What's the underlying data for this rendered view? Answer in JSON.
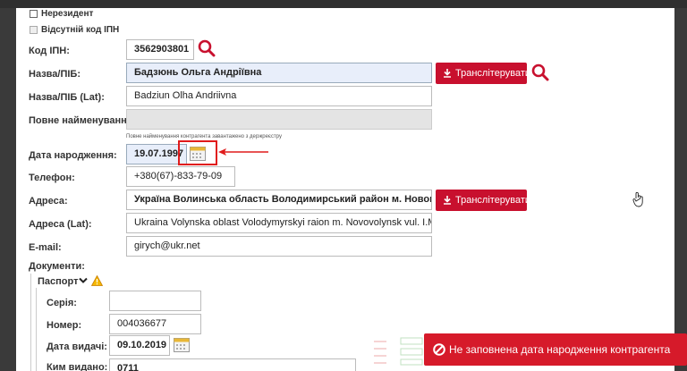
{
  "checkboxes": {
    "nonresident": "Нерезидент",
    "no_ipn": "Відсутній код ІПН"
  },
  "fields": {
    "ipn": {
      "label": "Код ІПН:",
      "value": "3562903801"
    },
    "name": {
      "label": "Назва/ПІБ:",
      "value": "Бадзюнь Ольга Андріївна"
    },
    "name_lat": {
      "label": "Назва/ПІБ (Lat):",
      "value": "Badziun Olha Andriivna"
    },
    "full_name": {
      "label": "Повне найменування:",
      "value": "",
      "hint": "Повне найменування контрагента завантажено з держреєстру"
    },
    "birth_date": {
      "label": "Дата народження:",
      "value": "19.07.1997"
    },
    "phone": {
      "label": "Телефон:",
      "value": "+380(67)-833-79-09"
    },
    "address": {
      "label": "Адреса:",
      "value": "Україна Волинська область Володимирський район м. Нововолинськ"
    },
    "address_lat": {
      "label": "Адреса (Lat):",
      "value": "Ukraina Volynska oblast Volodymyrskyi raion m. Novovolynsk vul. I.Maze"
    },
    "email": {
      "label": "E-mail:",
      "value": "girych@ukr.net"
    }
  },
  "documents": {
    "label": "Документи:",
    "passport": {
      "label": "Паспорт",
      "series": {
        "label": "Серія:",
        "value": ""
      },
      "number": {
        "label": "Номер:",
        "value": "004036677"
      },
      "issue_date": {
        "label": "Дата видачі:",
        "value": "09.10.2019"
      },
      "issued_by": {
        "label": "Ким видано:",
        "value": "0711"
      }
    }
  },
  "buttons": {
    "transliterate": "Транслітерувати"
  },
  "toast": {
    "message": "Не заповнена дата народження контрагента"
  },
  "colors": {
    "accent_red": "#c8102e",
    "toast_red": "#d61a2a",
    "highlight_box": "#e01b1b"
  }
}
